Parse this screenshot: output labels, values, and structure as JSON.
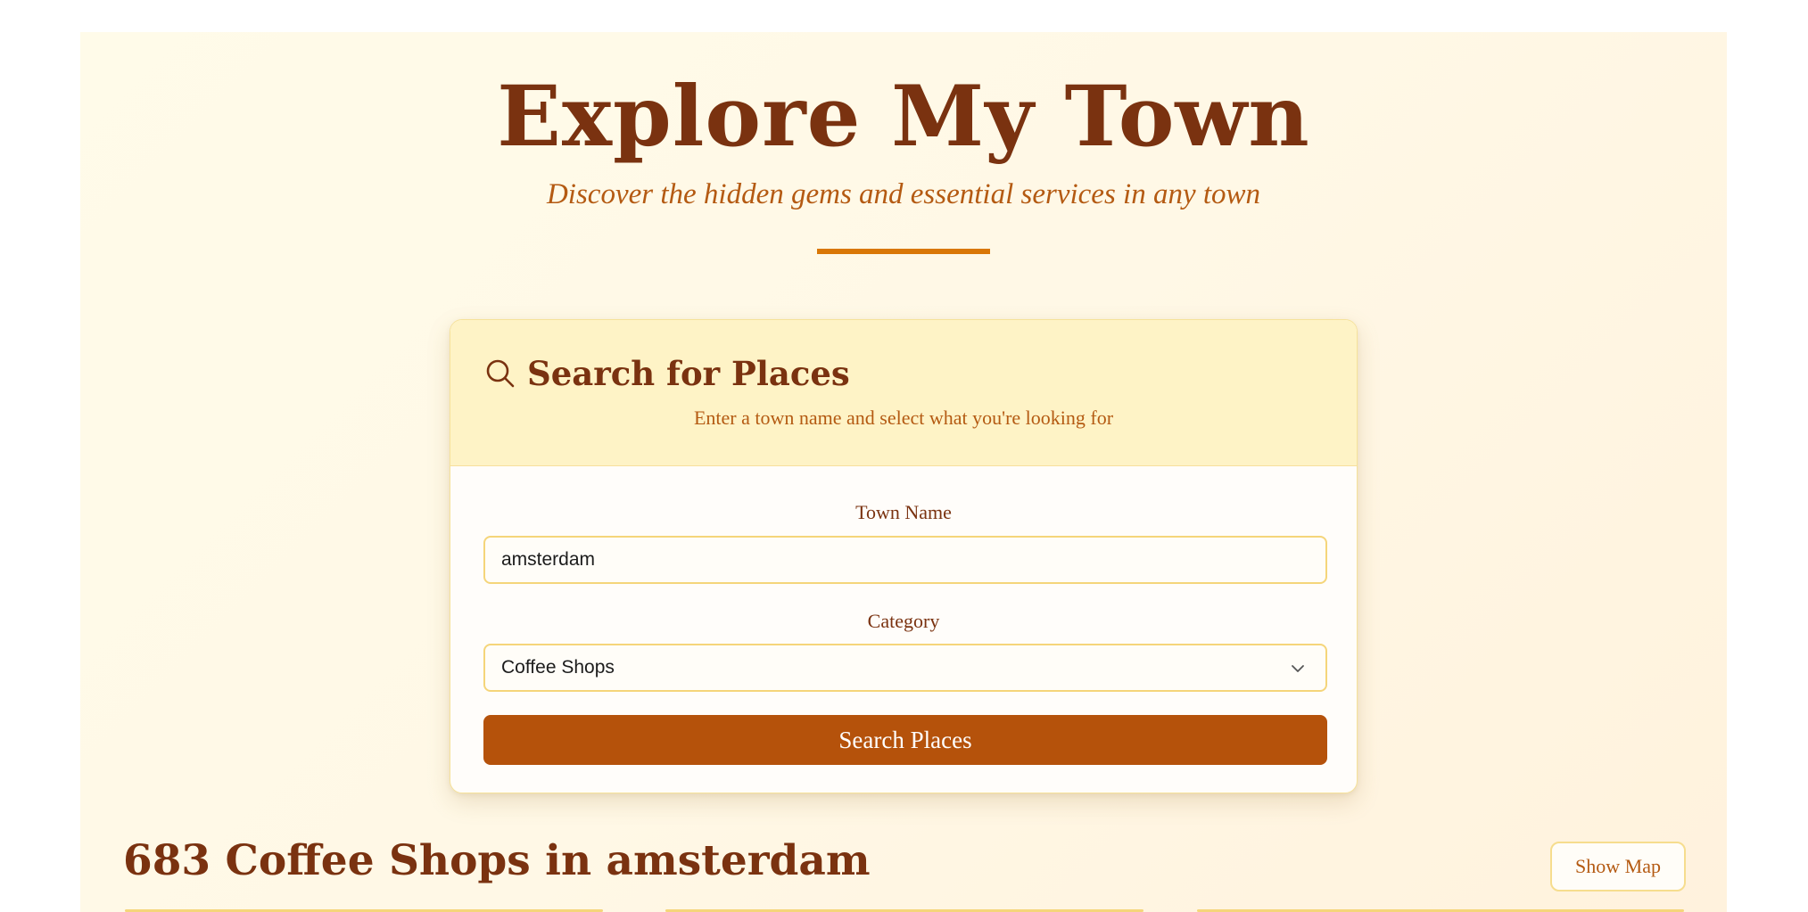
{
  "hero": {
    "title": "Explore My Town",
    "subtitle": "Discover the hidden gems and essential services in any town"
  },
  "search_card": {
    "icon": "search-icon",
    "title": "Search for Places",
    "description": "Enter a town name and select what you're looking for",
    "town_label": "Town Name",
    "town_value": "amsterdam",
    "category_label": "Category",
    "category_selected": "Coffee Shops",
    "submit_label": "Search Places"
  },
  "results": {
    "heading": "683 Coffee Shops in amsterdam",
    "show_map_label": "Show Map"
  },
  "colors": {
    "accent": "#b5520b",
    "title": "#7a3210",
    "subtitle": "#b45a12",
    "border": "#f5d57a"
  }
}
